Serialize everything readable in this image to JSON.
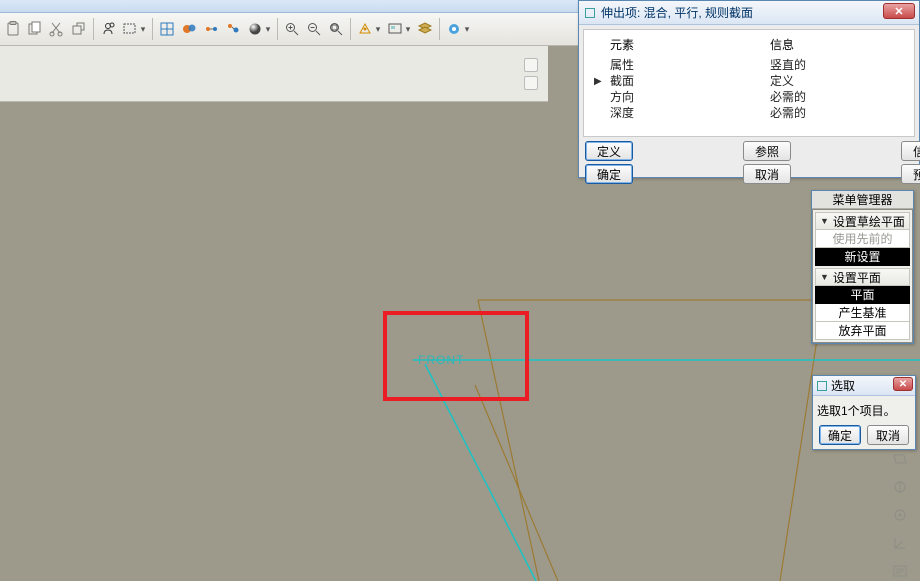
{
  "dialog_extrude": {
    "title": "伸出项: 混合, 平行, 规则截面",
    "columns": {
      "element": "元素",
      "info": "信息"
    },
    "rows": [
      {
        "element": "属性",
        "info": "竖直的",
        "current": false
      },
      {
        "element": "截面",
        "info": "定义",
        "current": true
      },
      {
        "element": "方向",
        "info": "必需的",
        "current": false
      },
      {
        "element": "深度",
        "info": "必需的",
        "current": false
      }
    ],
    "buttons": {
      "define": "定义",
      "ok": "确定",
      "reference": "参照",
      "cancel": "取消",
      "information": "信息",
      "preview": "预览"
    }
  },
  "menu_manager": {
    "title": "菜单管理器",
    "sections": [
      {
        "header": "设置草绘平面",
        "items": [
          {
            "label": "使用先前的",
            "state": "disabled"
          },
          {
            "label": "新设置",
            "state": "active"
          }
        ]
      },
      {
        "header": "设置平面",
        "items": [
          {
            "label": "平面",
            "state": "active"
          },
          {
            "label": "产生基准",
            "state": "normal"
          },
          {
            "label": "放弃平面",
            "state": "normal"
          }
        ]
      }
    ]
  },
  "select_dialog": {
    "title": "选取",
    "message": "选取1个项目。",
    "ok": "确定",
    "cancel": "取消"
  },
  "geometry": {
    "plane_label": "FRONT"
  },
  "toolbar": {
    "icons": [
      "paste-icon",
      "copy-icon",
      "cut-icon",
      "copy-props-icon",
      "find-icon",
      "select-rect-icon",
      "view-repaint-icon",
      "view-shade-icon",
      "view-wire-icon",
      "view-hidden-icon",
      "appearance-icon",
      "zoom-in-icon",
      "zoom-out-icon",
      "zoom-fit-icon",
      "orient-icon",
      "saved-views-icon",
      "layers-icon",
      "datum-toggle-icon"
    ]
  },
  "right_strip": {
    "icons": [
      "datum-plane-icon",
      "datum-axis-icon",
      "datum-point-icon",
      "datum-csys-icon",
      "annotations-icon"
    ]
  }
}
